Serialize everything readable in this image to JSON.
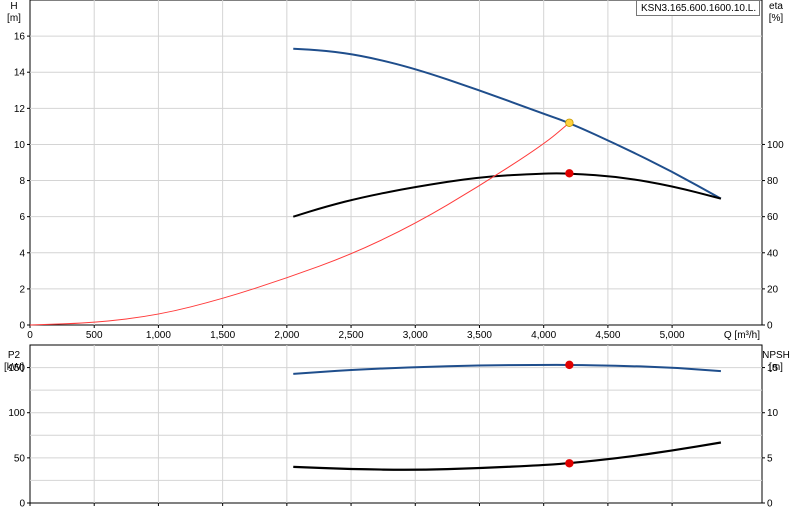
{
  "model_label": "KSN3.165.600.1600.10.L.",
  "chart_data": [
    {
      "type": "line",
      "xlabel": "Q [m³/h]",
      "xlim": [
        0,
        5700
      ],
      "x_ticks": [
        0,
        500,
        1000,
        1500,
        2000,
        2500,
        3000,
        3500,
        4000,
        4500,
        5000
      ],
      "x_tick_labels": [
        "0",
        "500",
        "1,000",
        "1,500",
        "2,000",
        "2,500",
        "3,000",
        "3,500",
        "4,000",
        "4,500",
        "5,000"
      ],
      "ylabel_left": "H\n[m]",
      "ylim_left": [
        0,
        18
      ],
      "y_ticks_left": [
        0,
        2,
        4,
        6,
        8,
        10,
        12,
        14,
        16
      ],
      "ylabel_right": "eta\n[%]",
      "ylim_right": [
        0,
        180
      ],
      "y_ticks_right": [
        0,
        20,
        40,
        60,
        80,
        100
      ],
      "grid": true,
      "series": [
        {
          "color": "#1f4e8c",
          "axis": "left",
          "x": [
            2050,
            2300,
            2600,
            3000,
            3500,
            4000,
            4200,
            4600,
            5000,
            5380
          ],
          "y": [
            15.3,
            15.2,
            14.9,
            14.2,
            13.0,
            11.7,
            11.2,
            9.9,
            8.5,
            7.0
          ]
        },
        {
          "color": "#000000",
          "axis": "right",
          "x": [
            2050,
            2300,
            2600,
            3000,
            3500,
            4000,
            4200,
            4600,
            5000,
            5380
          ],
          "y": [
            60,
            65.5,
            71,
            76.5,
            82,
            84,
            84,
            82,
            77,
            70
          ]
        },
        {
          "color": "#ff3b3b",
          "axis": "left",
          "x": [
            0,
            500,
            1000,
            1500,
            2000,
            2500,
            3000,
            3500,
            4000,
            4200
          ],
          "y": [
            0,
            0.12,
            0.55,
            1.45,
            2.6,
            3.9,
            5.6,
            7.7,
            10.0,
            11.2
          ]
        }
      ],
      "points": [
        {
          "x": 4200,
          "y": 11.2,
          "axis": "left",
          "color": "#ffd23f"
        },
        {
          "x": 4200,
          "y": 84,
          "axis": "right",
          "color": "#e00000"
        }
      ]
    },
    {
      "type": "line",
      "xlim": [
        0,
        5700
      ],
      "x_ticks": [
        0,
        500,
        1000,
        1500,
        2000,
        2500,
        3000,
        3500,
        4000,
        4500,
        5000
      ],
      "ylabel_left": "P2\n[kW]",
      "ylim_left": [
        0,
        175
      ],
      "y_ticks_left": [
        0,
        50,
        100,
        150
      ],
      "ylabel_right": "NPSH\n[m]",
      "ylim_right": [
        0,
        17.5
      ],
      "y_ticks_right": [
        0,
        5,
        10,
        15
      ],
      "grid": true,
      "series": [
        {
          "color": "#1f4e8c",
          "axis": "left",
          "x": [
            2050,
            2500,
            3000,
            3500,
            4000,
            4200,
            4600,
            5000,
            5380
          ],
          "y": [
            143,
            147.5,
            150.5,
            152.5,
            153,
            153,
            152,
            150,
            146
          ]
        },
        {
          "color": "#000000",
          "axis": "right",
          "x": [
            2050,
            2500,
            3000,
            3500,
            4000,
            4200,
            4600,
            5000,
            5380
          ],
          "y": [
            4.0,
            3.75,
            3.65,
            3.85,
            4.2,
            4.4,
            5.0,
            5.8,
            6.7
          ]
        }
      ],
      "points": [
        {
          "x": 4200,
          "y": 153,
          "axis": "left",
          "color": "#e00000"
        },
        {
          "x": 4200,
          "y": 4.4,
          "axis": "right",
          "color": "#e00000"
        }
      ]
    }
  ]
}
